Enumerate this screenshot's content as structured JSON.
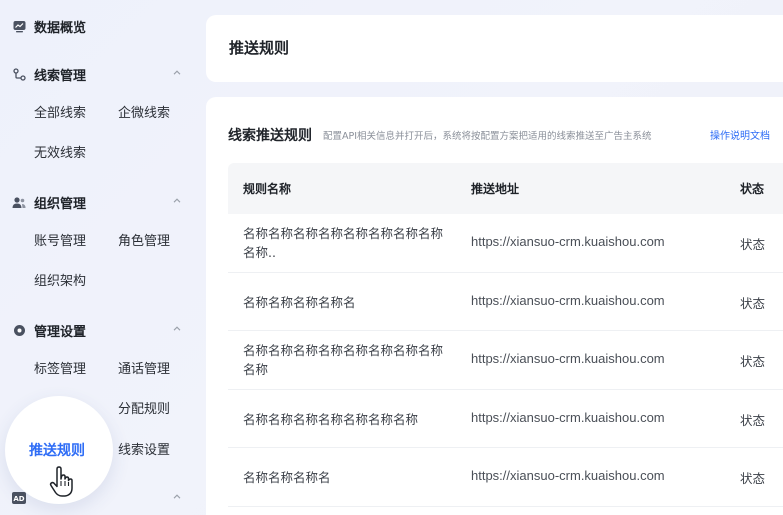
{
  "sidebar": {
    "groups": [
      {
        "label": "数据概览",
        "icon": "chart-icon",
        "collapsible": false
      },
      {
        "label": "线索管理",
        "icon": "branch-icon",
        "collapsible": true,
        "items": [
          "全部线索",
          "企微线索",
          "无效线索"
        ]
      },
      {
        "label": "组织管理",
        "icon": "users-icon",
        "collapsible": true,
        "items": [
          "账号管理",
          "角色管理",
          "组织架构"
        ]
      },
      {
        "label": "管理设置",
        "icon": "gear-icon",
        "collapsible": true,
        "items": [
          "标签管理",
          "通话管理",
          "分配规则",
          "推送规则",
          "线索设置"
        ]
      },
      {
        "icon": "ad-icon",
        "collapsible": true
      }
    ],
    "active_item": "推送规则"
  },
  "header": {
    "title": "推送规则"
  },
  "section": {
    "title": "线索推送规则",
    "description": "配置API相关信息并打开后，系统将按配置方案把适用的线索推送至广告主系统",
    "doc_link": "操作说明文档"
  },
  "table": {
    "columns": [
      "规则名称",
      "推送地址",
      "状态"
    ],
    "rows": [
      {
        "name": "名称名称名称名称名称名称名称名称名称..",
        "url": "https://xiansuo-crm.kuaishou.com",
        "status": "状态"
      },
      {
        "name": "名称名称名称名称名",
        "url": "https://xiansuo-crm.kuaishou.com",
        "status": "状态"
      },
      {
        "name": "名称名称名称名称名称名称名称名称名称",
        "url": "https://xiansuo-crm.kuaishou.com",
        "status": "状态"
      },
      {
        "name": "名称名称名称名称名称名称名称",
        "url": "https://xiansuo-crm.kuaishou.com",
        "status": "状态"
      },
      {
        "name": "名称名称名称名",
        "url": "https://xiansuo-crm.kuaishou.com",
        "status": "状态"
      }
    ]
  },
  "colors": {
    "accent": "#2d6cf6",
    "text": "#1f2329",
    "muted": "#8a8f99",
    "header_bg": "#f5f6f8"
  }
}
